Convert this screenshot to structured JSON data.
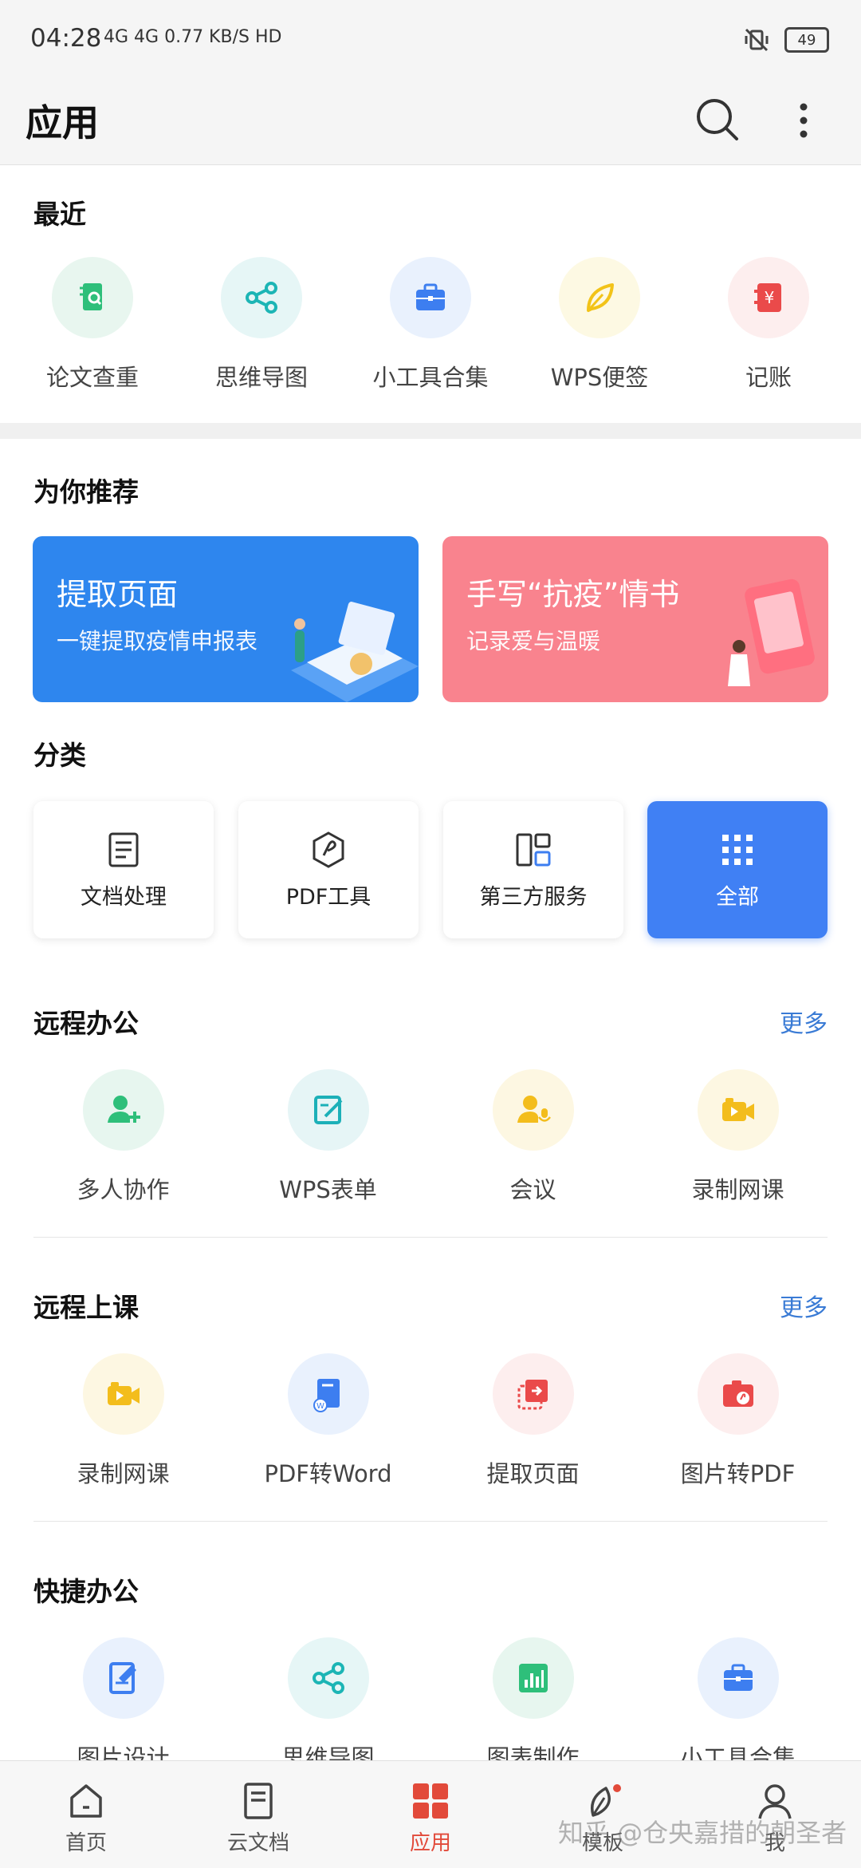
{
  "status": {
    "time": "04:28",
    "network": "4G 4G 0.77 KB/S HD",
    "battery": "49"
  },
  "header": {
    "title": "应用"
  },
  "recent": {
    "title": "最近",
    "items": [
      {
        "label": "论文查重",
        "icon": "paper-check-icon",
        "bg": "#e8f6ef",
        "fg": "#2ebf7a"
      },
      {
        "label": "思维导图",
        "icon": "mindmap-icon",
        "bg": "#e6f6f6",
        "fg": "#1cb5b5"
      },
      {
        "label": "小工具合集",
        "icon": "toolbox-icon",
        "bg": "#e9f1fd",
        "fg": "#3d7ef0"
      },
      {
        "label": "WPS便签",
        "icon": "leaf-icon",
        "bg": "#fdf9e3",
        "fg": "#f2c318"
      },
      {
        "label": "记账",
        "icon": "ledger-icon",
        "bg": "#fdeeee",
        "fg": "#ea4a4a"
      }
    ]
  },
  "recommend": {
    "title": "为你推荐",
    "banners": [
      {
        "title": "提取页面",
        "subtitle": "一键提取疫情申报表",
        "color": "#2e86ee"
      },
      {
        "title": "手写“抗疫”情书",
        "subtitle": "记录爱与温暖",
        "color": "#f9838e"
      }
    ]
  },
  "category": {
    "title": "分类",
    "items": [
      {
        "label": "文档处理",
        "icon": "document-icon"
      },
      {
        "label": "PDF工具",
        "icon": "pdf-icon"
      },
      {
        "label": "第三方服务",
        "icon": "third-party-icon"
      },
      {
        "label": "全部",
        "icon": "grid-icon",
        "active_color": "#4080f4"
      }
    ]
  },
  "remote_office": {
    "title": "远程办公",
    "more": "更多",
    "items": [
      {
        "label": "多人协作",
        "icon": "add-user-icon",
        "bg": "#e7f6ef",
        "fg": "#2ebf7a"
      },
      {
        "label": "WPS表单",
        "icon": "form-edit-icon",
        "bg": "#e6f5f6",
        "fg": "#1cb0b8"
      },
      {
        "label": "会议",
        "icon": "meeting-icon",
        "bg": "#fdf7e2",
        "fg": "#f3bd1c"
      },
      {
        "label": "录制网课",
        "icon": "video-icon",
        "bg": "#fdf7e2",
        "fg": "#f3bd1c"
      }
    ]
  },
  "remote_class": {
    "title": "远程上课",
    "more": "更多",
    "items": [
      {
        "label": "录制网课",
        "icon": "video-icon",
        "bg": "#fdf7e2",
        "fg": "#f3bd1c"
      },
      {
        "label": "PDF转Word",
        "icon": "pdf-to-word-icon",
        "bg": "#e9f1fd",
        "fg": "#3d7ef0"
      },
      {
        "label": "提取页面",
        "icon": "extract-page-icon",
        "bg": "#fdeeee",
        "fg": "#ea4a4a"
      },
      {
        "label": "图片转PDF",
        "icon": "image-to-pdf-icon",
        "bg": "#fdeeee",
        "fg": "#ea4a4a"
      }
    ]
  },
  "quick_office": {
    "title": "快捷办公",
    "items": [
      {
        "label": "图片设计",
        "icon": "image-design-icon",
        "bg": "#e9f1fd",
        "fg": "#3d7ef0"
      },
      {
        "label": "思维导图",
        "icon": "mindmap-icon",
        "bg": "#e6f6f6",
        "fg": "#1cb5b5"
      },
      {
        "label": "图表制作",
        "icon": "chart-icon",
        "bg": "#e7f6ef",
        "fg": "#2ebf7a"
      },
      {
        "label": "小工具合集",
        "icon": "toolbox-icon",
        "bg": "#e9f1fd",
        "fg": "#3d7ef0"
      }
    ]
  },
  "nav": {
    "items": [
      {
        "label": "首页",
        "icon": "home-icon"
      },
      {
        "label": "云文档",
        "icon": "cloud-doc-icon"
      },
      {
        "label": "应用",
        "icon": "apps-icon",
        "active_color": "#e24a3a"
      },
      {
        "label": "模板",
        "icon": "template-icon"
      },
      {
        "label": "我",
        "icon": "profile-icon"
      }
    ]
  },
  "watermark": "知乎 @仓央嘉措的朝圣者"
}
